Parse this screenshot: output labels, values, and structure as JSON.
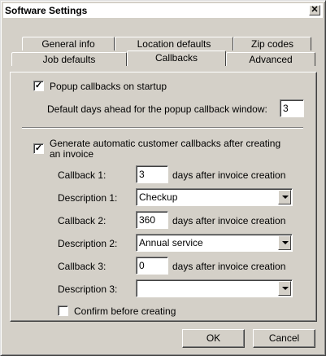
{
  "window": {
    "title": "Software Settings",
    "close_glyph": "✕"
  },
  "tabs": {
    "row1": [
      "General info",
      "Location defaults",
      "Zip codes"
    ],
    "row2": [
      "Job defaults",
      "Callbacks",
      "Advanced"
    ],
    "active": "Callbacks"
  },
  "popup": {
    "checkbox_label": "Popup callbacks on startup",
    "checked": true,
    "days_label": "Default days ahead for the popup callback window:",
    "days_value": "3"
  },
  "auto": {
    "checkbox_label_line1": "Generate automatic customer callbacks after creating",
    "checkbox_label_line2": "an invoice",
    "checked": true,
    "suffix": "days after invoice creation",
    "rows": [
      {
        "callback_label": "Callback 1:",
        "callback_value": "3",
        "desc_label": "Description 1:",
        "desc_value": "Checkup"
      },
      {
        "callback_label": "Callback 2:",
        "callback_value": "360",
        "desc_label": "Description 2:",
        "desc_value": "Annual service"
      },
      {
        "callback_label": "Callback 3:",
        "callback_value": "0",
        "desc_label": "Description 3:",
        "desc_value": ""
      }
    ],
    "confirm_label": "Confirm before creating",
    "confirm_checked": false
  },
  "buttons": {
    "ok": "OK",
    "cancel": "Cancel"
  },
  "icons": {
    "check": "check-mark-icon",
    "dropdown": "chevron-down-icon",
    "close": "close-icon"
  }
}
